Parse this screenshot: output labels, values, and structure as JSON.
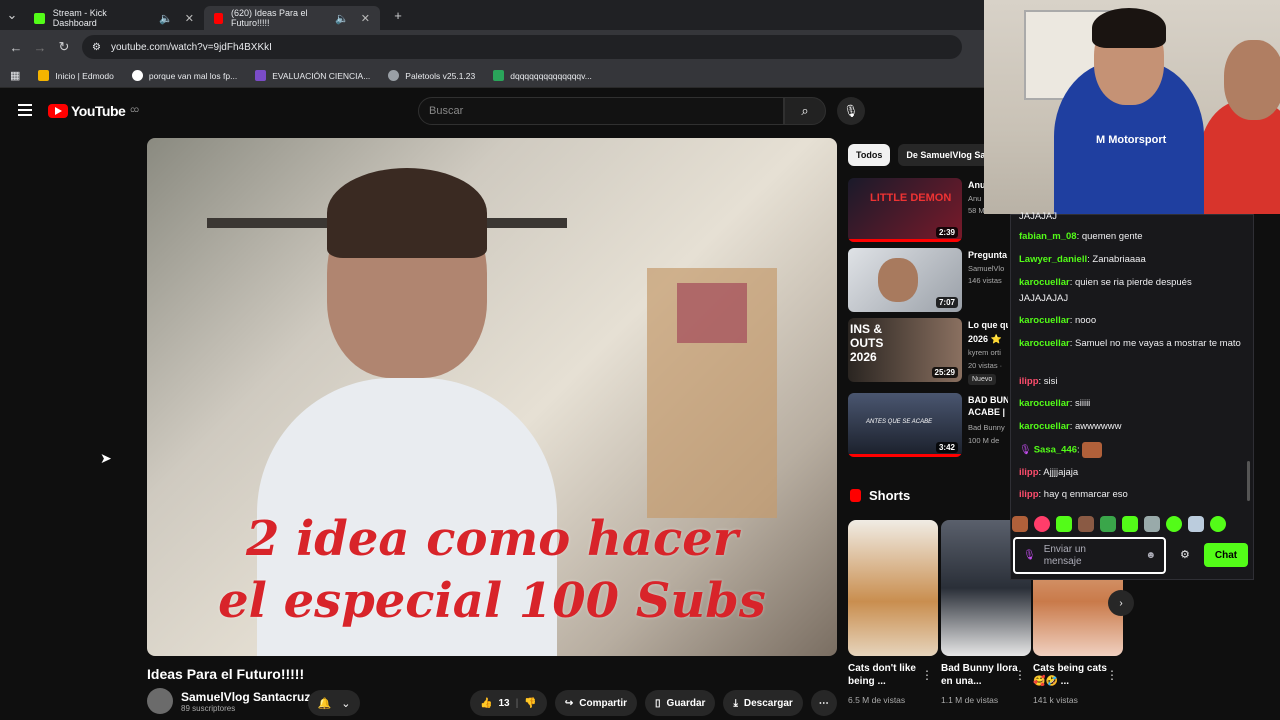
{
  "browser": {
    "tabs": [
      {
        "label": "Stream - Kick Dashboard",
        "fav_color": "#53fc18"
      },
      {
        "label": "(620) Ideas Para el Futuro!!!!!",
        "fav_color": "#ff0000"
      }
    ],
    "url": "youtube.com/watch?v=9jdFh4BXKkI",
    "bookmarks": [
      {
        "label": "Inicio | Edmodo",
        "color": "#f5b400"
      },
      {
        "label": "porque van mal los fp...",
        "color": "#ffffff"
      },
      {
        "label": "EVALUACIÓN CIENCIA...",
        "color": "#7b4cc8"
      },
      {
        "label": "Paletools v25.1.23",
        "color": "#9aa0a6"
      },
      {
        "label": "dqqqqqqqqqqqqqqv...",
        "color": "#2aa55a"
      }
    ]
  },
  "youtube": {
    "logo": "YouTube",
    "country": "CO",
    "search_placeholder": "Buscar"
  },
  "video": {
    "overlay_line1": "2 idea como hacer",
    "overlay_line2": "el especial 100 Subs",
    "title": "Ideas Para el Futuro!!!!!",
    "channel": "SamuelVlog Santacruz",
    "subs": "89 suscriptores",
    "likes": "13",
    "share": "Compartir",
    "save": "Guardar",
    "download": "Descargar"
  },
  "filters": [
    "Todos",
    "De SamuelVlog Sa"
  ],
  "recommended": [
    {
      "title": "Anu",
      "meta1": "Anu",
      "meta2": "58 M de",
      "duration": "2:39",
      "thumb_color": "#1a1a2a"
    },
    {
      "title": "Pregunta",
      "meta1": "SamuelVlo",
      "meta2": "146 vistas",
      "duration": "7:07",
      "thumb_color": "#c8cbd2"
    },
    {
      "title": "Lo que qu",
      "title2": "2026 ⭐",
      "meta1": "kyrem orti",
      "meta2": "20 vistas ·",
      "duration": "25:29",
      "thumb_color": "#2a2521",
      "thumb_text": "INS & OUTS 2026",
      "badge": "Nuevo"
    },
    {
      "title": "BAD BUN",
      "title2": "ACABE |",
      "meta1": "Bad Bunny",
      "meta2": "100 M de",
      "duration": "3:42",
      "thumb_color": "#2a3344",
      "thumb_text": "ANTES QUE SE ACABE"
    }
  ],
  "shorts": {
    "heading": "Shorts",
    "items": [
      {
        "title": "Cats don't like being ...",
        "views": "6.5 M de vistas",
        "color": "#c98e4f"
      },
      {
        "title": "Bad Bunny llora en una...",
        "views": "1.1 M de vistas",
        "color": "#3a3f4a"
      },
      {
        "title": "Cats being cats 🥰🤣 ...",
        "views": "141 k vistas",
        "color": "#c97a4a"
      }
    ]
  },
  "webcam": {
    "shirt_text": "M Motorsport"
  },
  "chat": {
    "messages": [
      {
        "user": "",
        "text": "JAJAJAJ",
        "color": "#efeff1"
      },
      {
        "user": "fabian_m_08",
        "text": ": quemen gente",
        "color": "#53fc18"
      },
      {
        "user": "Lawyer_daniell",
        "text": ": Zanabriaaaa",
        "color": "#53fc18"
      },
      {
        "user": "karocuellar",
        "text": ": quien se ria pierde después JAJAJAJAJ",
        "color": "#53fc18"
      },
      {
        "user": "karocuellar",
        "text": ": nooo",
        "color": "#53fc18"
      },
      {
        "user": "karocuellar",
        "text": ": Samuel no me vayas a mostrar te mato",
        "color": "#53fc18"
      },
      {
        "user": "ilipp",
        "text": ": sisi",
        "color": "#ff4d6d"
      },
      {
        "user": "karocuellar",
        "text": ": siiiii",
        "color": "#53fc18"
      },
      {
        "user": "karocuellar",
        "text": ": awwwwww",
        "color": "#53fc18"
      },
      {
        "user": "Sasa_446",
        "text": ":",
        "color": "#53fc18"
      },
      {
        "user": "ilipp",
        "text": ": Ajjjjajaja",
        "color": "#ff4d6d"
      },
      {
        "user": "ilipp",
        "text": ": hay q enmarcar eso",
        "color": "#ff4d6d"
      }
    ],
    "input_placeholder": "Enviar un mensaje",
    "send_label": "Chat"
  }
}
